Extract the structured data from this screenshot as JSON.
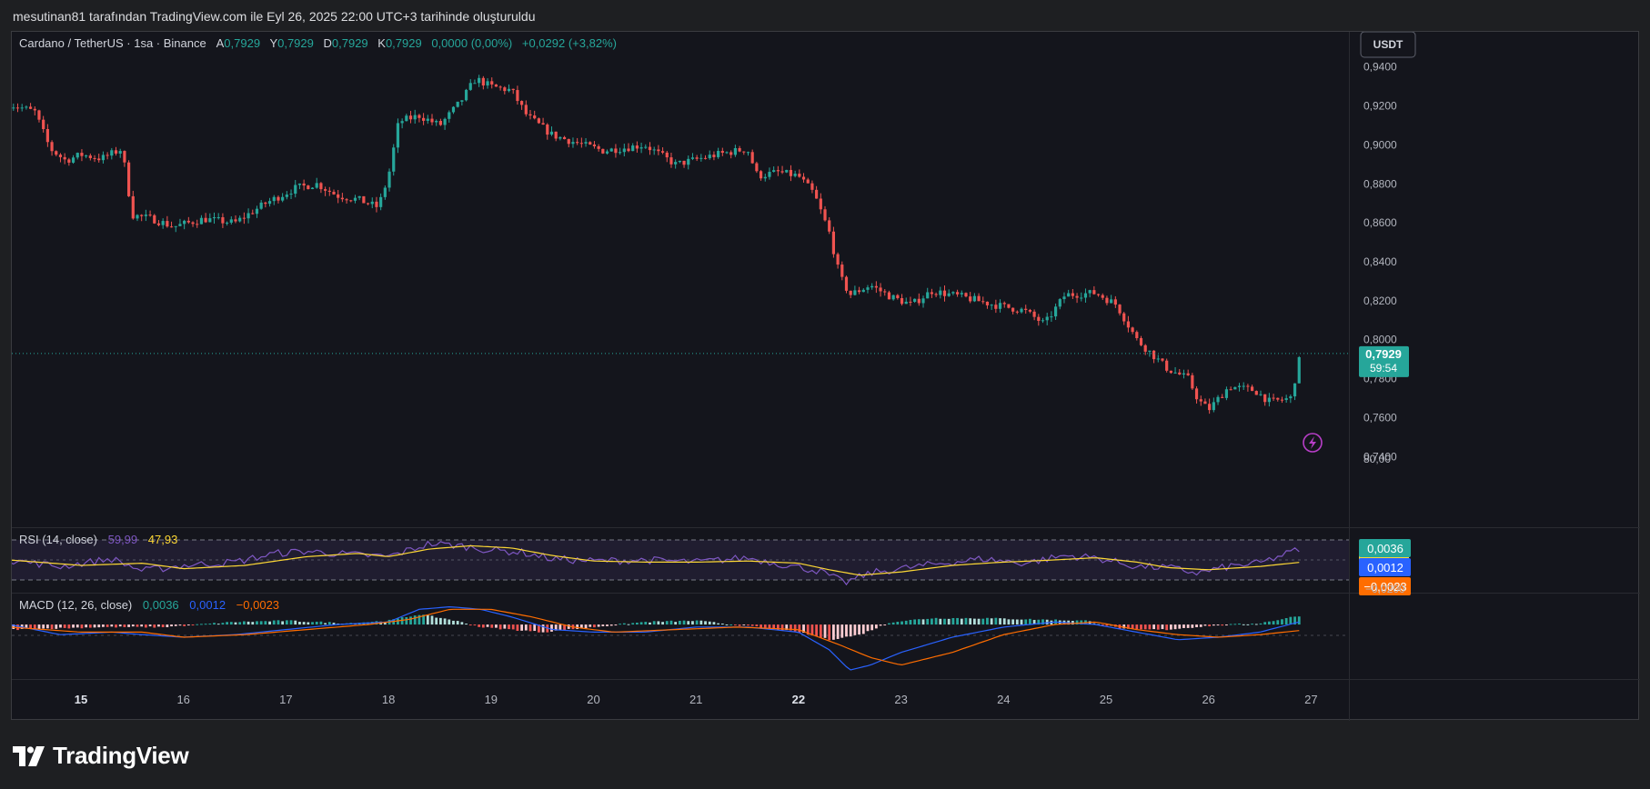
{
  "caption": "mesutinan81 tarafından TradingView.com ile Eyl 26, 2025 22:00 UTC+3 tarihinde oluşturuldu",
  "brand": "TradingView",
  "colors": {
    "up": "#26a69a",
    "down": "#ef5350",
    "rsi": "#7e57c2",
    "rsi_ma": "#fdd835",
    "macd": "#2962ff",
    "signal": "#ff6d00"
  },
  "header": {
    "symbol": "Cardano / TetherUS · 1sa · Binance",
    "o_label": "A",
    "o_value": "0,7929",
    "h_label": "Y",
    "h_value": "0,7929",
    "l_label": "D",
    "l_value": "0,7929",
    "c_label": "K",
    "c_value": "0,7929",
    "change": "0,0000 (0,00%)",
    "change2": "+0,0292 (+3,82%)"
  },
  "currency_button": "USDT",
  "price_badge": {
    "price": "0,7929",
    "countdown": "59:54"
  },
  "rsi": {
    "label": "RSI (14, close)",
    "value": "59,99",
    "ma": "47,93",
    "axis_label": "80,00"
  },
  "macd": {
    "label": "MACD (12, 26, close)",
    "hist": "0,0036",
    "macd": "0,0012",
    "signal": "−0,0023",
    "axis_label": "−0,0200"
  },
  "chart_data": [
    {
      "type": "candlestick",
      "title": "Cardano / TetherUS · 1sa · Binance",
      "ylim": [
        0.735,
        0.945
      ],
      "y_ticks": [
        "0,9400",
        "0,9200",
        "0,9000",
        "0,8800",
        "0,8600",
        "0,8400",
        "0,8200",
        "0,8000",
        "0,7800",
        "0,7600",
        "0,7400"
      ],
      "x_ticks": [
        "15",
        "16",
        "17",
        "18",
        "19",
        "20",
        "21",
        "22",
        "23",
        "24",
        "25",
        "26",
        "27"
      ],
      "last_price": 0.7929,
      "close_path": [
        [
          14.3,
          0.921
        ],
        [
          14.55,
          0.917
        ],
        [
          14.7,
          0.898
        ],
        [
          14.85,
          0.892
        ],
        [
          15.0,
          0.895
        ],
        [
          15.2,
          0.893
        ],
        [
          15.4,
          0.898
        ],
        [
          15.5,
          0.864
        ],
        [
          15.7,
          0.862
        ],
        [
          15.9,
          0.858
        ],
        [
          16.2,
          0.862
        ],
        [
          16.5,
          0.86
        ],
        [
          16.8,
          0.87
        ],
        [
          17.1,
          0.878
        ],
        [
          17.3,
          0.88
        ],
        [
          17.5,
          0.874
        ],
        [
          17.7,
          0.872
        ],
        [
          17.9,
          0.868
        ],
        [
          18.0,
          0.884
        ],
        [
          18.1,
          0.912
        ],
        [
          18.3,
          0.915
        ],
        [
          18.5,
          0.91
        ],
        [
          18.7,
          0.922
        ],
        [
          18.85,
          0.934
        ],
        [
          19.0,
          0.93
        ],
        [
          19.2,
          0.928
        ],
        [
          19.35,
          0.915
        ],
        [
          19.6,
          0.905
        ],
        [
          19.9,
          0.9
        ],
        [
          20.1,
          0.897
        ],
        [
          20.5,
          0.9
        ],
        [
          20.8,
          0.89
        ],
        [
          21.2,
          0.895
        ],
        [
          21.5,
          0.898
        ],
        [
          21.6,
          0.884
        ],
        [
          21.8,
          0.886
        ],
        [
          22.0,
          0.884
        ],
        [
          22.15,
          0.875
        ],
        [
          22.3,
          0.855
        ],
        [
          22.4,
          0.833
        ],
        [
          22.5,
          0.823
        ],
        [
          22.7,
          0.828
        ],
        [
          22.9,
          0.822
        ],
        [
          23.1,
          0.818
        ],
        [
          23.3,
          0.825
        ],
        [
          23.6,
          0.822
        ],
        [
          23.9,
          0.818
        ],
        [
          24.2,
          0.815
        ],
        [
          24.4,
          0.808
        ],
        [
          24.6,
          0.823
        ],
        [
          24.9,
          0.824
        ],
        [
          25.1,
          0.818
        ],
        [
          25.3,
          0.8
        ],
        [
          25.6,
          0.785
        ],
        [
          25.8,
          0.78
        ],
        [
          25.9,
          0.769
        ],
        [
          26.0,
          0.764
        ],
        [
          26.2,
          0.776
        ],
        [
          26.45,
          0.774
        ],
        [
          26.6,
          0.768
        ],
        [
          26.8,
          0.77
        ],
        [
          26.9,
          0.7929
        ]
      ]
    },
    {
      "type": "line",
      "title": "RSI (14, close)",
      "ylim": [
        20,
        80
      ],
      "series": [
        {
          "name": "RSI",
          "x": [
            14.3,
            14.8,
            15.3,
            15.6,
            16.0,
            16.5,
            16.9,
            17.2,
            17.6,
            18.0,
            18.4,
            18.7,
            19.0,
            19.3,
            19.6,
            20.0,
            20.5,
            21.0,
            21.5,
            21.9,
            22.2,
            22.45,
            22.7,
            23.0,
            23.4,
            23.8,
            24.2,
            24.6,
            24.9,
            25.3,
            25.6,
            25.9,
            26.2,
            26.5,
            26.8,
            26.9
          ],
          "values": [
            50,
            44,
            51,
            40,
            45,
            48,
            56,
            58,
            55,
            53,
            65,
            63,
            59,
            57,
            51,
            49,
            50,
            48,
            52,
            45,
            40,
            29,
            38,
            42,
            47,
            51,
            47,
            54,
            52,
            44,
            43,
            38,
            44,
            47,
            57,
            59.99
          ]
        },
        {
          "name": "MA",
          "x": [
            14.3,
            15.0,
            15.6,
            16.0,
            16.6,
            17.2,
            17.7,
            18.0,
            18.4,
            18.8,
            19.2,
            19.6,
            20.0,
            20.5,
            21.0,
            21.5,
            22.0,
            22.3,
            22.6,
            23.0,
            23.5,
            24.0,
            24.5,
            24.9,
            25.3,
            25.6,
            26.0,
            26.5,
            26.9
          ],
          "values": [
            50,
            45,
            47,
            42,
            45,
            53,
            56,
            53,
            60,
            63,
            61,
            54,
            49,
            48,
            48,
            49,
            47,
            41,
            36,
            39,
            45,
            48,
            50,
            52,
            48,
            43,
            41,
            44,
            47.93
          ]
        }
      ]
    },
    {
      "type": "bar+line",
      "title": "MACD (12, 26, close)",
      "ylim": [
        -0.0215,
        0.0115
      ],
      "histogram_path": [
        [
          14.3,
          -0.002
        ],
        [
          15.2,
          -0.001
        ],
        [
          15.8,
          -0.001
        ],
        [
          16.5,
          0.001
        ],
        [
          17.0,
          0.0015
        ],
        [
          17.6,
          0.0005
        ],
        [
          18.0,
          0.0015
        ],
        [
          18.3,
          0.004
        ],
        [
          18.6,
          0.002
        ],
        [
          18.9,
          -0.001
        ],
        [
          19.2,
          -0.002
        ],
        [
          19.5,
          -0.003
        ],
        [
          20.0,
          -0.001
        ],
        [
          20.5,
          0.001
        ],
        [
          21.0,
          0.0015
        ],
        [
          21.6,
          -0.001
        ],
        [
          22.0,
          -0.003
        ],
        [
          22.3,
          -0.006
        ],
        [
          22.6,
          -0.004
        ],
        [
          22.9,
          0.001
        ],
        [
          23.3,
          0.0025
        ],
        [
          23.8,
          0.0025
        ],
        [
          24.3,
          0.002
        ],
        [
          24.8,
          0.0015
        ],
        [
          25.2,
          -0.002
        ],
        [
          25.6,
          -0.002
        ],
        [
          26.0,
          -0.0005
        ],
        [
          26.5,
          0.0005
        ],
        [
          26.9,
          0.0036
        ]
      ],
      "series": [
        {
          "name": "MACD",
          "x": [
            14.3,
            14.8,
            15.3,
            15.6,
            16.0,
            16.5,
            17.0,
            17.5,
            18.0,
            18.3,
            18.6,
            18.9,
            19.2,
            19.6,
            20.0,
            20.5,
            21.0,
            21.5,
            22.0,
            22.3,
            22.5,
            22.7,
            23.0,
            23.5,
            24.0,
            24.5,
            24.9,
            25.3,
            25.7,
            26.1,
            26.5,
            26.9
          ],
          "values": [
            0,
            -0.004,
            -0.003,
            -0.004,
            -0.005,
            -0.004,
            -0.002,
            0,
            0.001,
            0.006,
            0.007,
            0.006,
            0.003,
            -0.002,
            -0.003,
            -0.003,
            -0.001,
            -0.001,
            -0.003,
            -0.01,
            -0.018,
            -0.016,
            -0.011,
            -0.005,
            -0.001,
            0.001,
            0,
            -0.003,
            -0.006,
            -0.005,
            -0.003,
            0.0012
          ]
        },
        {
          "name": "Signal",
          "x": [
            14.3,
            15.0,
            15.6,
            16.0,
            16.6,
            17.2,
            17.8,
            18.2,
            18.6,
            19.0,
            19.4,
            19.8,
            20.2,
            20.8,
            21.4,
            22.0,
            22.4,
            22.7,
            23.0,
            23.5,
            24.0,
            24.5,
            24.9,
            25.3,
            25.7,
            26.1,
            26.5,
            26.9
          ],
          "values": [
            -0.001,
            -0.003,
            -0.003,
            -0.005,
            -0.004,
            -0.002,
            0,
            0.002,
            0.006,
            0.006,
            0.003,
            -0.001,
            -0.003,
            -0.002,
            -0.001,
            -0.002,
            -0.008,
            -0.013,
            -0.016,
            -0.011,
            -0.004,
            0,
            0.001,
            -0.002,
            -0.004,
            -0.005,
            -0.004,
            -0.0023
          ]
        }
      ]
    }
  ]
}
